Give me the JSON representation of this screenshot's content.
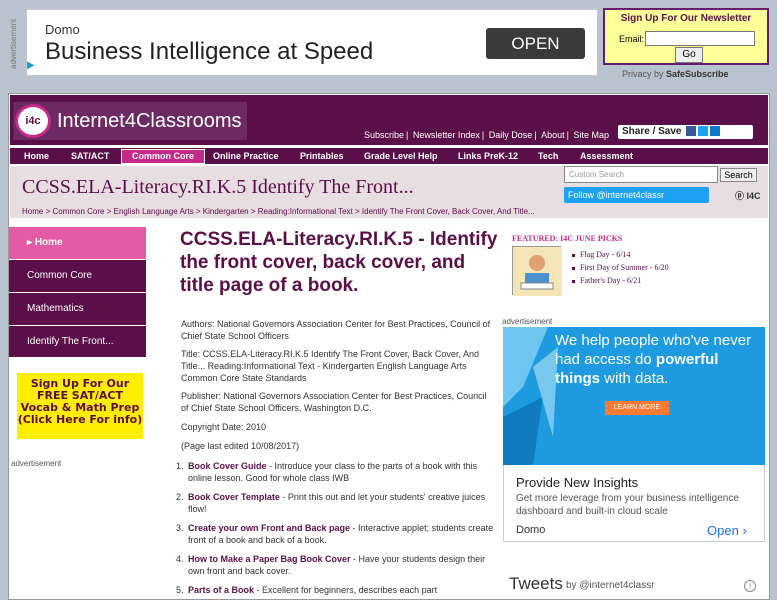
{
  "topad": {
    "label": "advertisement",
    "brand": "Domo",
    "headline": "Business Intelligence at Speed",
    "button": "OPEN"
  },
  "newsletter": {
    "title": "Sign Up For Our Newsletter",
    "email_label": "Email:",
    "email_value": "",
    "go_label": "Go",
    "privacy_by": "Privacy by",
    "privacy_brand": "SafeSubscribe"
  },
  "header": {
    "logo_mark": "i4c",
    "site_name": "Internet4Classrooms",
    "top_links": [
      "Subscribe",
      "Newsletter Index",
      "Daily Dose",
      "About",
      "Site Map"
    ],
    "share_label": "Share / Save"
  },
  "nav": {
    "items": [
      "Home",
      "SAT/ACT",
      "Common Core",
      "Online Practice",
      "Printables",
      "Grade Level Help",
      "Links PreK-12",
      "Tech",
      "Assessment"
    ],
    "active": "Common Core"
  },
  "band": {
    "title": "CCSS.ELA-Literacy.RI.K.5 Identify The Front...",
    "breadcrumbs": [
      "Home",
      "Common Core",
      "English Language Arts",
      "Kindergarten",
      "Reading:Informational Text",
      "Identify The Front Cover, Back Cover, And Title..."
    ],
    "search_placeholder": "Custom Search",
    "search_button": "Search",
    "follow_label": "Follow @internet4classr",
    "pin_label": "I4C"
  },
  "sidebar": {
    "items": [
      "Home",
      "Common Core",
      "Mathematics",
      "Identify The Front..."
    ],
    "sat_box": "Sign Up For Our FREE SAT/ACT Vocab & Math Prep (Click Here For info)",
    "ad_label": "advertisement"
  },
  "content": {
    "title": "CCSS.ELA-Literacy.RI.K.5 - Identify the front cover, back cover, and title page of a book.",
    "authors": "Authors: National Governors Association Center for Best Practices, Council of Chief State School Officers",
    "title_line": "Title: CCSS.ELA-Literacy.RI.K.5 Identify The Front Cover, Back Cover, And Title... Reading:Informational Text - Kindergarten English Language Arts Common Core State Standards",
    "publisher": "Publisher: National Governors Association Center for Best Practices, Council of Chief State School Officers, Washington D.C.",
    "copyright": "Copyright Date: 2010",
    "last_edited": "(Page last edited 10/08/2017)",
    "items": [
      {
        "num": "1.",
        "link": "Book Cover Guide",
        "desc": " - Introduce your class to the parts of a book with this online lesson. Good for whole class IWB"
      },
      {
        "num": "2.",
        "link": "Book Cover Template",
        "desc": " - Print this out and let your students' creative juices flow!"
      },
      {
        "num": "3.",
        "link": "Create your own Front and Back page",
        "desc": " - Interactive applet; students create front of a book and back of a book."
      },
      {
        "num": "4.",
        "link": "How to Make a Paper Bag Book Cover",
        "desc": " - Have your students design their own front and back cover."
      },
      {
        "num": "5.",
        "link": "Parts of a Book",
        "desc": " - Excellent for beginners, describes each part"
      }
    ]
  },
  "featured": {
    "heading": "FEATURED: I4C JUNE PICKS",
    "items": [
      "Flag Day - 6/14",
      "First Day of Summer - 6/20",
      "Father's Day - 6/21"
    ]
  },
  "rightad": {
    "label": "advertisement",
    "tagline_pre": "We help people who've never had access do ",
    "tagline_b1": "powerful things",
    "tagline_post": " with data.",
    "learn_more": "LEARN MORE",
    "headline": "Provide New Insights",
    "desc": "Get more leverage from your business intelligence dashboard and built-in cloud scale",
    "brand": "Domo",
    "open": "Open"
  },
  "tweets": {
    "title": "Tweets",
    "by": "by @internet4classr"
  },
  "colors": {
    "brand": "#5b0f48",
    "accent": "#c52a8a",
    "sat_box": "#ffee00",
    "ad_blue": "#1e9be0"
  }
}
